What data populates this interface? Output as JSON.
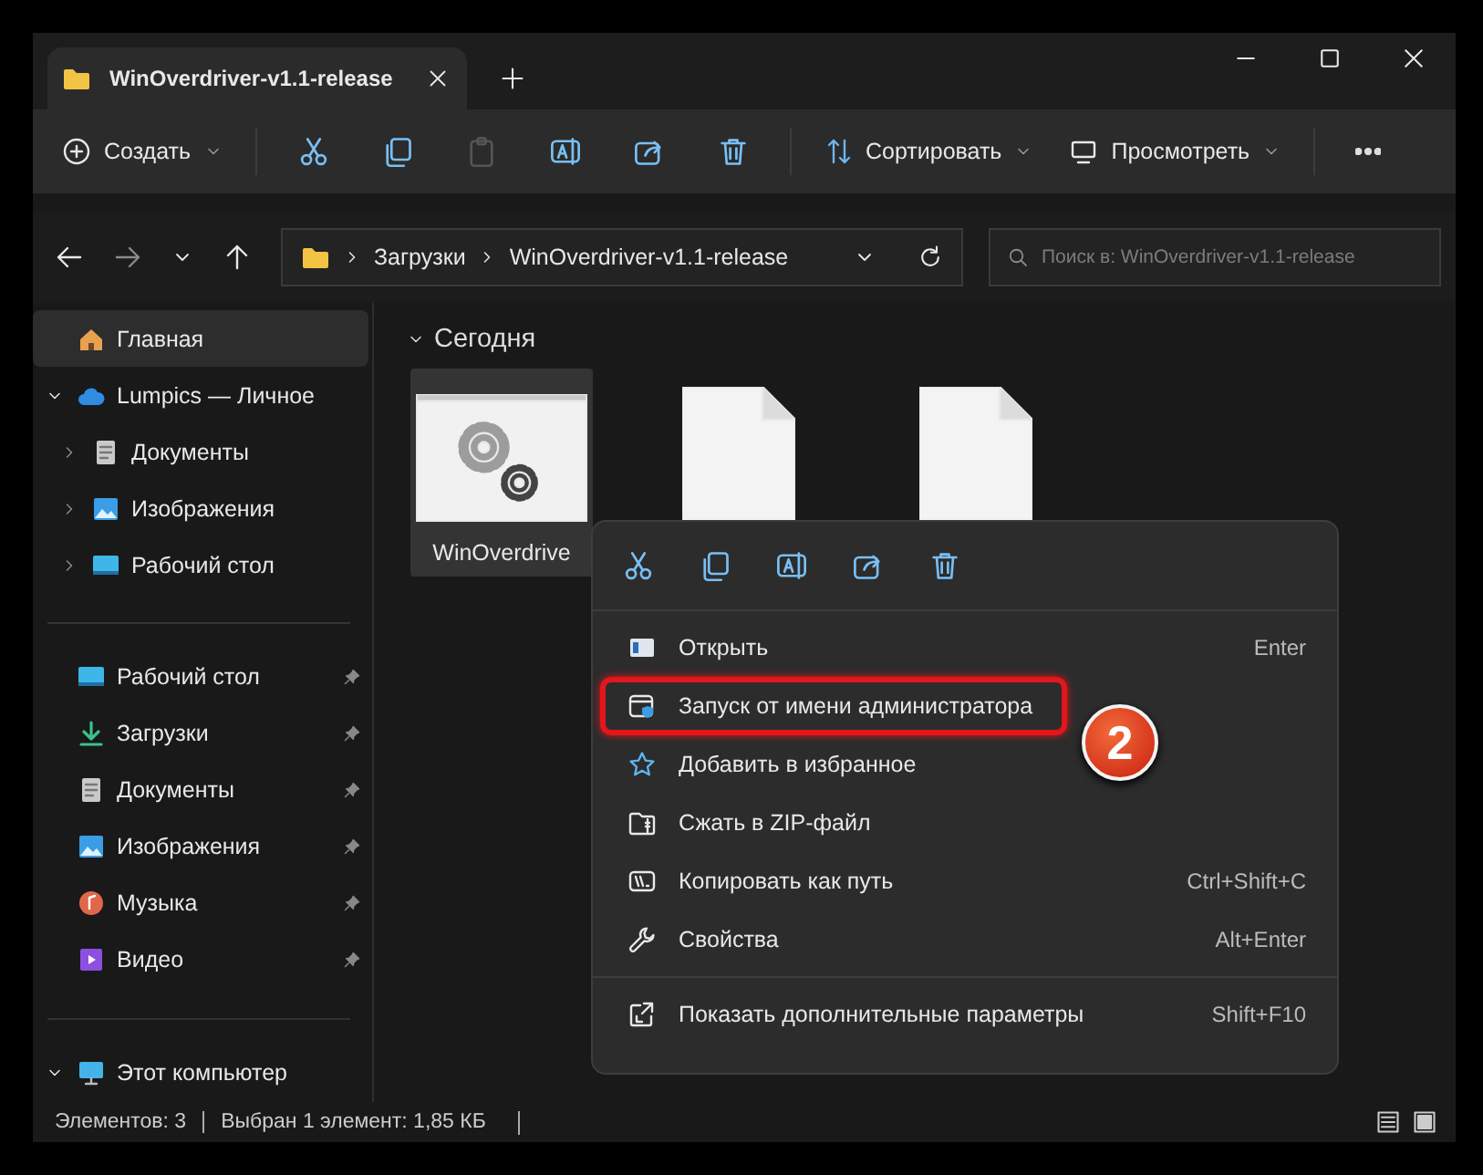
{
  "window": {
    "tab_title": "WinOverdriver-v1.1-release"
  },
  "toolbar": {
    "create": "Создать",
    "sort": "Сортировать",
    "view": "Просмотреть",
    "actions": [
      {
        "disabled": false
      },
      {
        "disabled": false
      },
      {
        "disabled": true
      },
      {
        "disabled": false
      },
      {
        "disabled": false
      },
      {
        "disabled": false
      }
    ]
  },
  "address": {
    "path": [
      "Загрузки",
      "WinOverdriver-v1.1-release"
    ],
    "search_placeholder": "Поиск в: WinOverdriver-v1.1-release"
  },
  "sidebar": {
    "groups": [
      [
        {
          "label": "Главная",
          "kind": "home",
          "selected": true
        },
        {
          "label": "Lumpics — Личное",
          "kind": "cloud",
          "selected": false,
          "expanded": true,
          "children": [
            {
              "label": "Документы",
              "kind": "docs",
              "selected": false,
              "expanded": false
            },
            {
              "label": "Изображения",
              "kind": "pictures",
              "selected": false,
              "expanded": false
            },
            {
              "label": "Рабочий стол",
              "kind": "desktop",
              "selected": false,
              "expanded": false
            }
          ]
        }
      ],
      [
        {
          "label": "Рабочий стол",
          "kind": "desktop",
          "selected": false,
          "pinned": true
        },
        {
          "label": "Загрузки",
          "kind": "downloads",
          "selected": false,
          "pinned": true
        },
        {
          "label": "Документы",
          "kind": "docs",
          "selected": false,
          "pinned": true
        },
        {
          "label": "Изображения",
          "kind": "pictures",
          "selected": false,
          "pinned": true
        },
        {
          "label": "Музыка",
          "kind": "music",
          "selected": false,
          "pinned": true
        },
        {
          "label": "Видео",
          "kind": "video",
          "selected": false,
          "pinned": true
        }
      ],
      [
        {
          "label": "Этот компьютер",
          "kind": "pc",
          "selected": false,
          "expanded": true
        }
      ]
    ]
  },
  "content": {
    "group": "Сегодня",
    "group_expanded": true,
    "files": [
      {
        "name": "WinOverdrive",
        "kind": "app",
        "selected": true
      },
      {
        "kind": "file",
        "selected": false
      },
      {
        "kind": "file",
        "selected": false
      }
    ]
  },
  "context_menu": {
    "items": [
      {
        "label": "Открыть",
        "shortcut": "Enter",
        "highlighted": false
      },
      {
        "label": "Запуск от имени администратора",
        "highlighted": true
      },
      {
        "label": "Добавить в избранное",
        "highlighted": false
      },
      {
        "label": "Сжать в ZIP-файл",
        "highlighted": false
      },
      {
        "label": "Копировать как путь",
        "shortcut": "Ctrl+Shift+C",
        "highlighted": false
      },
      {
        "label": "Свойства",
        "shortcut": "Alt+Enter",
        "highlighted": false
      }
    ],
    "extra_item": {
      "label": "Показать дополнительные параметры",
      "shortcut": "Shift+F10"
    },
    "callout": "2"
  },
  "status_bar": {
    "items": [
      "Элементов: 3",
      "Выбран 1 элемент: 1,85 КБ"
    ]
  }
}
